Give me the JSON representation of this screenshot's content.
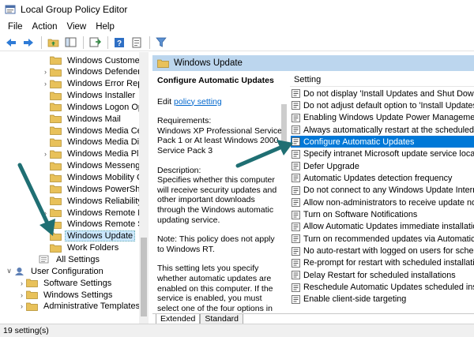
{
  "window": {
    "title": "Local Group Policy Editor"
  },
  "menu": [
    "File",
    "Action",
    "View",
    "Help"
  ],
  "toolbar_icons": [
    "back-icon",
    "forward-icon",
    "folder-up-icon",
    "show-hide-tree-icon",
    "export-list-icon",
    "help-icon",
    "properties-icon",
    "filter-icon"
  ],
  "tree": {
    "items": [
      {
        "label": "Windows Customer E"
      },
      {
        "label": "Windows Defender",
        "expandable": true
      },
      {
        "label": "Windows Error Report",
        "expandable": true
      },
      {
        "label": "Windows Installer"
      },
      {
        "label": "Windows Logon Opti"
      },
      {
        "label": "Windows Mail"
      },
      {
        "label": "Windows Media Cent"
      },
      {
        "label": "Windows Media Digit"
      },
      {
        "label": "Windows Media Playe",
        "expandable": true
      },
      {
        "label": "Windows Messenger"
      },
      {
        "label": "Windows Mobility Ce"
      },
      {
        "label": "Windows PowerShell"
      },
      {
        "label": "Windows Reliability A"
      },
      {
        "label": "Windows Remote Ma",
        "expandable": true
      },
      {
        "label": "Windows Remote She"
      },
      {
        "label": "Windows Update",
        "selected": true
      },
      {
        "label": "Work Folders"
      },
      {
        "label": "All Settings"
      },
      {
        "label": "User Configuration",
        "expandable": true,
        "expanded": true
      },
      {
        "label": "Software Settings",
        "expandable": true
      },
      {
        "label": "Windows Settings",
        "expandable": true
      },
      {
        "label": "Administrative Templates",
        "expandable": true
      }
    ]
  },
  "right_header": {
    "title": "Windows Update"
  },
  "description": {
    "title": "Configure Automatic Updates",
    "edit_prefix": "Edit ",
    "edit_link": "policy setting ",
    "requirements": "Requirements:\nWindows XP Professional Service Pack 1 or At least Windows 2000 Service Pack 3",
    "desc_label": "Description:",
    "desc_text": "Specifies whether this computer will receive security updates and other important downloads through the Windows automatic updating service.",
    "note": "Note: This policy does not apply to Windows RT.",
    "more": "This setting lets you specify whether automatic updates are enabled on this computer. If the service is enabled, you must select one of the four options in the Group Policy Setting:"
  },
  "list": {
    "column_header": "Setting",
    "rows": [
      "Do not display 'Install Updates and Shut Down' opt",
      "Do not adjust default option to 'Install Updates and",
      "Enabling Windows Update Power Management to",
      "Always automatically restart at the scheduled time",
      "Configure Automatic Updates",
      "Specify intranet Microsoft update service location",
      "Defer Upgrade",
      "Automatic Updates detection frequency",
      "Do not connect to any Windows Update Internet lo",
      "Allow non-administrators to receive update notifi",
      "Turn on Software Notifications",
      "Allow Automatic Updates immediate installation",
      "Turn on recommended updates via Automatic Up",
      "No auto-restart with logged on users for schedule",
      "Re-prompt for restart with scheduled installations",
      "Delay Restart for scheduled installations",
      "Reschedule Automatic Updates scheduled install",
      "Enable client-side targeting"
    ],
    "selected_index": 4
  },
  "tabs": [
    "Extended",
    "Standard"
  ],
  "status": {
    "text": "19 setting(s)"
  },
  "colors": {
    "selection": "#0078d7",
    "header": "#bcd6ee",
    "arrow": "#1f6f73",
    "folder": "#e8c15a"
  }
}
